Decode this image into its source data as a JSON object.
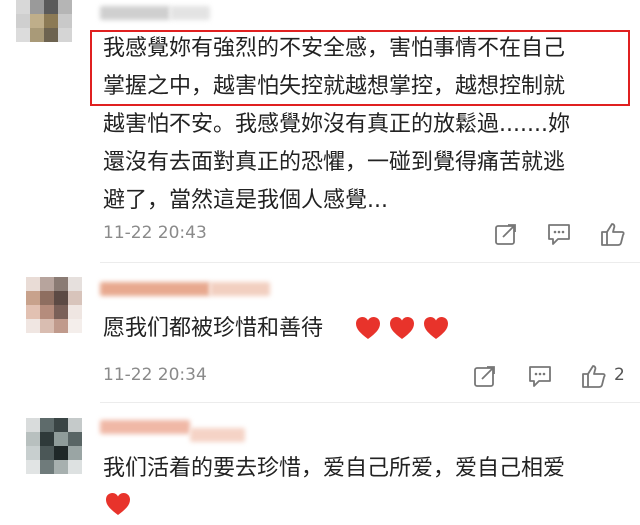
{
  "comments": [
    {
      "text": "我感覺妳有強烈的不安全感，害怕事情不在自己\n掌握之中，越害怕失控就越想掌控，越想控制就\n越害怕不安。我感覺妳沒有真正的放鬆過.......妳\n還沒有去面對真正的恐懼，一碰到覺得痛苦就逃\n避了，當然這是我個人感覺...",
      "time": "11-22 20:43",
      "likes": ""
    },
    {
      "text": "愿我们都被珍惜和善待",
      "time": "11-22 20:34",
      "likes": "2"
    },
    {
      "text": "我们活着的要去珍惜，爱自己所爱，爱自己相爱",
      "time": "",
      "likes": ""
    }
  ],
  "icons": {
    "share": "share-icon",
    "comment": "comment-icon",
    "like": "thumbs-up-icon",
    "heart": "heart-icon"
  },
  "colors": {
    "highlight_border": "#e02020",
    "heart": "#e8332b",
    "timestamp": "#8a8a8a"
  }
}
